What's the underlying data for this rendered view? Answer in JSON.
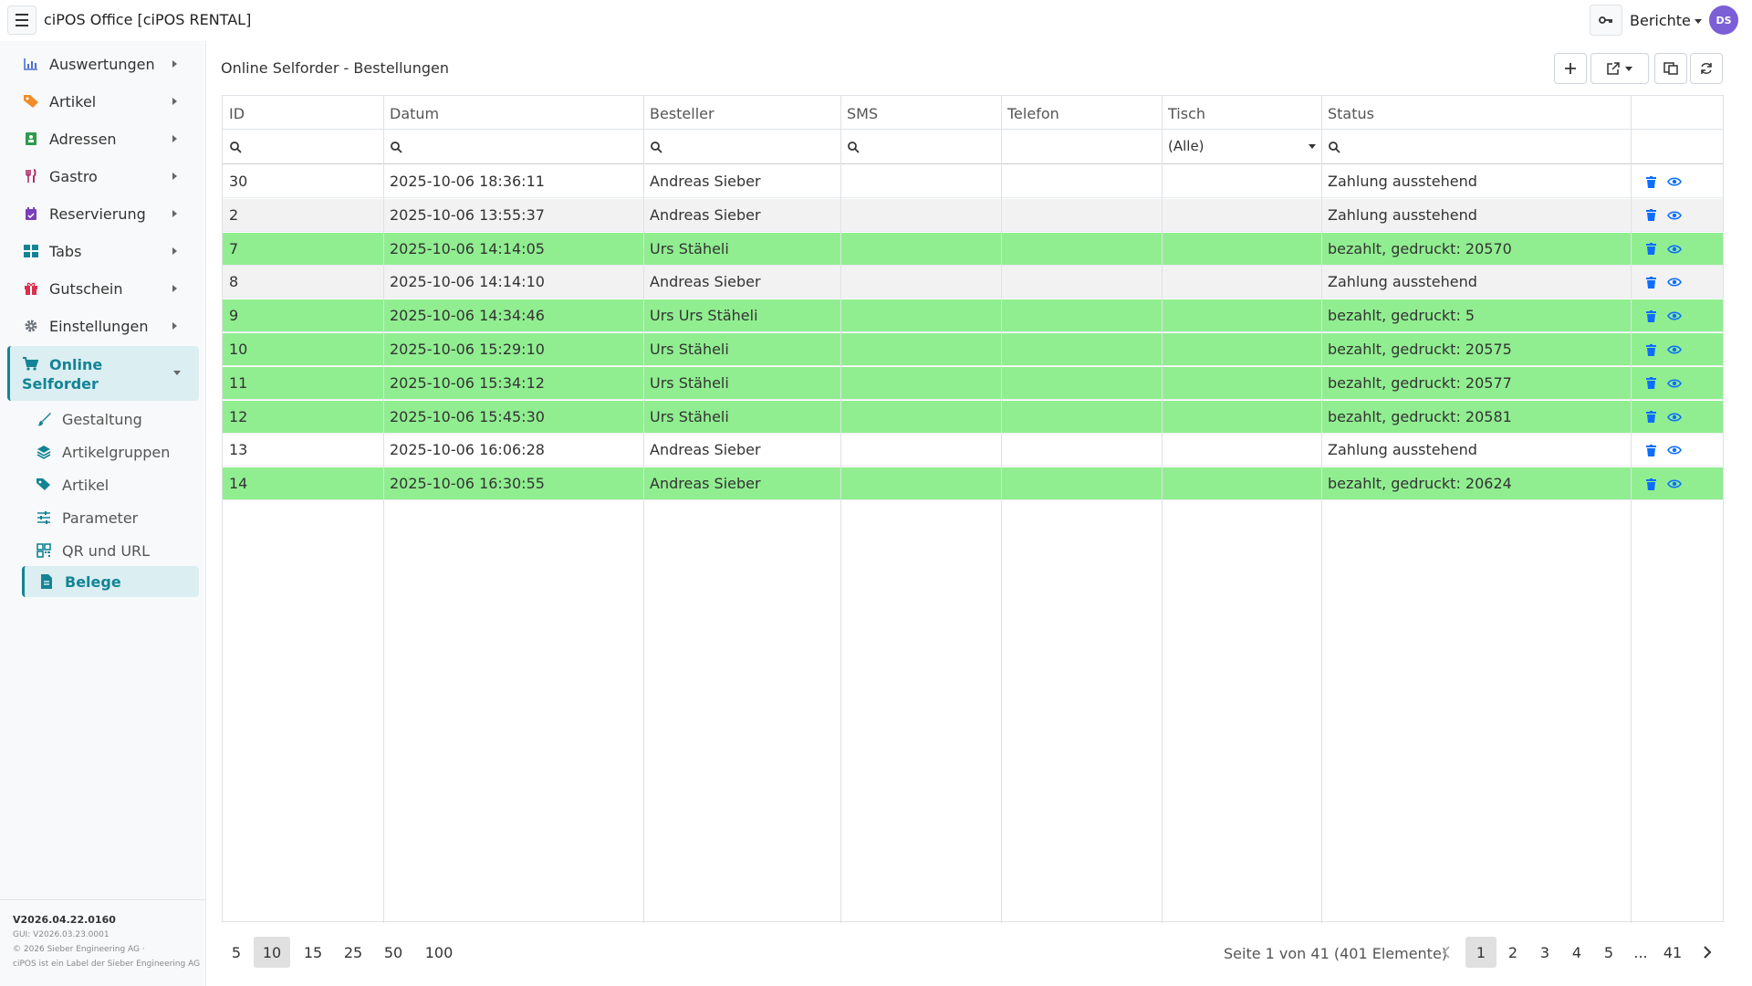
{
  "app": {
    "title": "ciPOS Office [ciPOS RENTAL]"
  },
  "header": {
    "reports_label": "Berichte",
    "avatar_initials": "DS"
  },
  "sidebar": {
    "items": [
      {
        "label": "Auswertungen",
        "icon": "chart-icon"
      },
      {
        "label": "Artikel",
        "icon": "tag-icon"
      },
      {
        "label": "Adressen",
        "icon": "address-book-icon"
      },
      {
        "label": "Gastro",
        "icon": "utensils-icon"
      },
      {
        "label": "Reservierung",
        "icon": "calendar-icon"
      },
      {
        "label": "Tabs",
        "icon": "grid-icon"
      },
      {
        "label": "Gutschein",
        "icon": "gift-icon"
      },
      {
        "label": "Einstellungen",
        "icon": "gear-icon"
      }
    ],
    "active_item": {
      "label_line1": "Online",
      "label_line2": "Selforder",
      "icon": "cart-icon"
    },
    "sub_items": [
      {
        "label": "Gestaltung",
        "icon": "brush-icon"
      },
      {
        "label": "Artikelgruppen",
        "icon": "layers-icon"
      },
      {
        "label": "Artikel",
        "icon": "tags-icon"
      },
      {
        "label": "Parameter",
        "icon": "sliders-icon"
      },
      {
        "label": "QR und URL",
        "icon": "qr-icon"
      },
      {
        "label": "Belege",
        "icon": "document-icon",
        "active": true
      }
    ],
    "footer": {
      "version": "V2026.04.22.0160",
      "gui": "GUI: V2026.03.23.0001",
      "copyright": "© 2026 Sieber Engineering AG ·",
      "label": "ciPOS ist ein Label der Sieber Engineering AG"
    }
  },
  "main": {
    "title": "Online Selforder - Bestellungen",
    "columns": [
      "ID",
      "Datum",
      "Besteller",
      "SMS",
      "Telefon",
      "Tisch",
      "Status"
    ],
    "tisch_filter": "(Alle)",
    "rows": [
      {
        "id": "30",
        "datum": "2025-10-06 18:36:11",
        "besteller": "Andreas Sieber",
        "status": "Zahlung ausstehend",
        "paid": false
      },
      {
        "id": "2",
        "datum": "2025-10-06 13:55:37",
        "besteller": "Andreas Sieber",
        "status": "Zahlung ausstehend",
        "paid": false
      },
      {
        "id": "7",
        "datum": "2025-10-06 14:14:05",
        "besteller": "Urs Stäheli",
        "status": "bezahlt, gedruckt: 20570",
        "paid": true
      },
      {
        "id": "8",
        "datum": "2025-10-06 14:14:10",
        "besteller": "Andreas Sieber",
        "status": "Zahlung ausstehend",
        "paid": false
      },
      {
        "id": "9",
        "datum": "2025-10-06 14:34:46",
        "besteller": "Urs Urs Stäheli",
        "status": "bezahlt, gedruckt: 5",
        "paid": true
      },
      {
        "id": "10",
        "datum": "2025-10-06 15:29:10",
        "besteller": "Urs Stäheli",
        "status": "bezahlt, gedruckt: 20575",
        "paid": true
      },
      {
        "id": "11",
        "datum": "2025-10-06 15:34:12",
        "besteller": "Urs Stäheli",
        "status": "bezahlt, gedruckt: 20577",
        "paid": true
      },
      {
        "id": "12",
        "datum": "2025-10-06 15:45:30",
        "besteller": "Urs Stäheli",
        "status": "bezahlt, gedruckt: 20581",
        "paid": true
      },
      {
        "id": "13",
        "datum": "2025-10-06 16:06:28",
        "besteller": "Andreas Sieber",
        "status": "Zahlung ausstehend",
        "paid": false
      },
      {
        "id": "14",
        "datum": "2025-10-06 16:30:55",
        "besteller": "Andreas Sieber",
        "status": "bezahlt, gedruckt: 20624",
        "paid": true
      }
    ]
  },
  "pager": {
    "page_sizes": [
      "5",
      "10",
      "15",
      "25",
      "50",
      "100"
    ],
    "selected_page_size": "10",
    "info": "Seite 1 von 41 (401 Elemente)",
    "pages": [
      "1",
      "2",
      "3",
      "4",
      "5",
      "...",
      "41"
    ],
    "current_page": "1"
  },
  "colors": {
    "accent": "#138496",
    "paid_row": "#90ee90",
    "icon_blue": "#0d6efd",
    "avatar": "#7b5fd6"
  }
}
